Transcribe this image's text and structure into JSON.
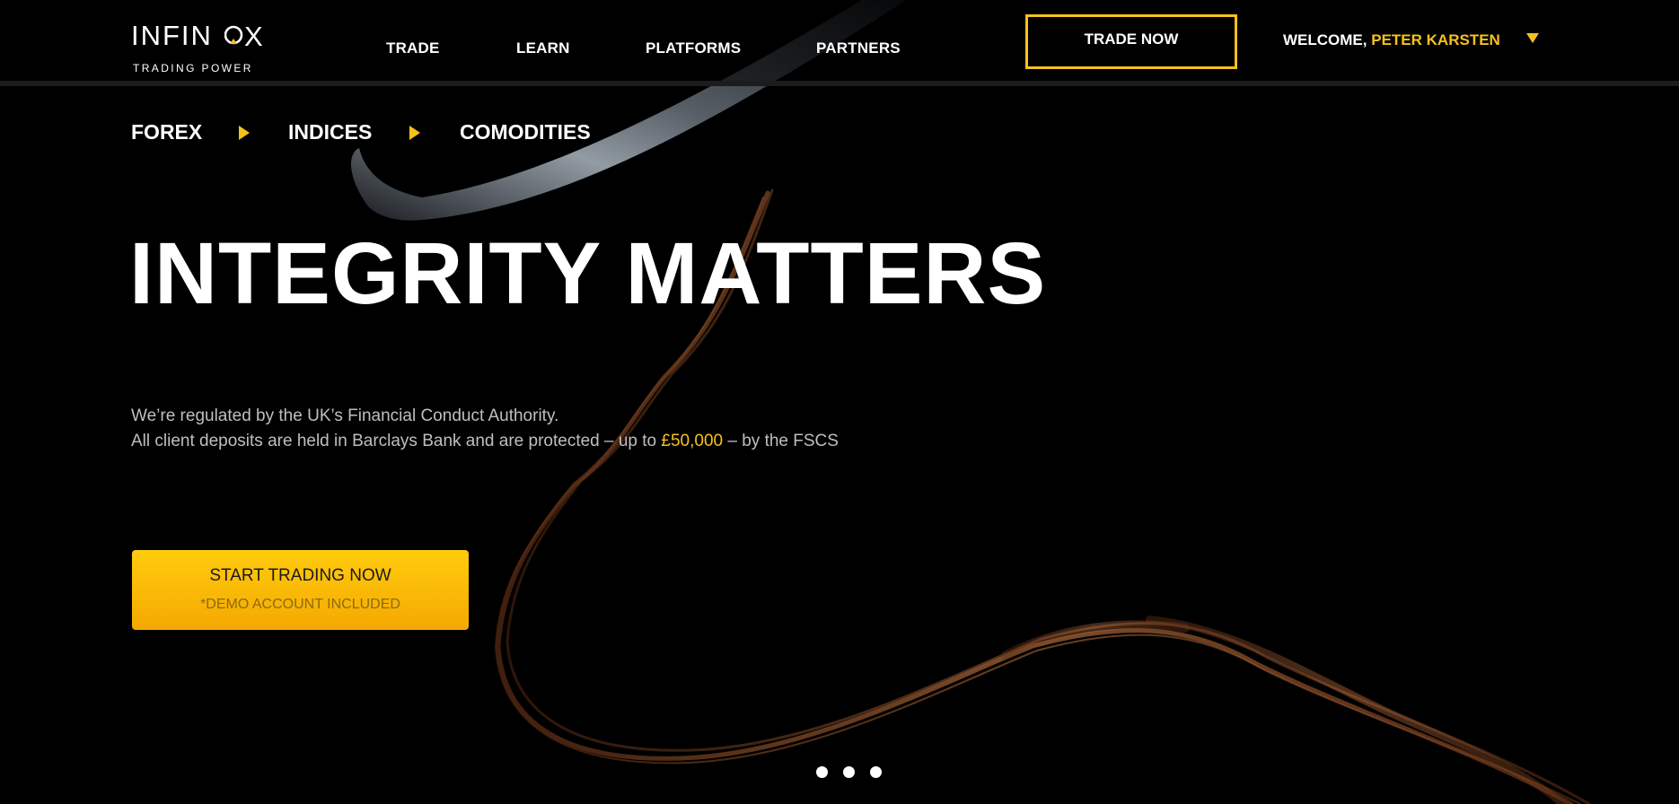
{
  "brand": {
    "name": "INFINOX",
    "word_prefix": "INFIN",
    "word_suffix": "X",
    "tagline": "TRADING POWER",
    "accent_color": "#f5c21b"
  },
  "nav": {
    "items": [
      {
        "label": "TRADE"
      },
      {
        "label": "LEARN"
      },
      {
        "label": "PLATFORMS"
      },
      {
        "label": "PARTNERS"
      }
    ],
    "trade_now_label": "TRADE NOW"
  },
  "user": {
    "welcome_label": "WELCOME,",
    "name": "PETER KARSTEN",
    "menu_icon": "caret-down-icon"
  },
  "subnav": {
    "items": [
      {
        "label": "FOREX"
      },
      {
        "label": "INDICES"
      },
      {
        "label": "COMODITIES"
      }
    ],
    "separator_icon": "caret-right-icon"
  },
  "hero": {
    "title": "INTEGRITY MATTERS",
    "line1": "We’re regulated by the UK’s Financial Conduct Authority.",
    "line2_prefix": "All client deposits are held in Barclays Bank and are protected – up to ",
    "line2_amount": "£50,000",
    "line2_suffix": " – by the FSCS",
    "cta_label": "START TRADING NOW",
    "cta_sublabel": "*DEMO ACCOUNT INCLUDED"
  },
  "carousel": {
    "slide_count": 3
  }
}
